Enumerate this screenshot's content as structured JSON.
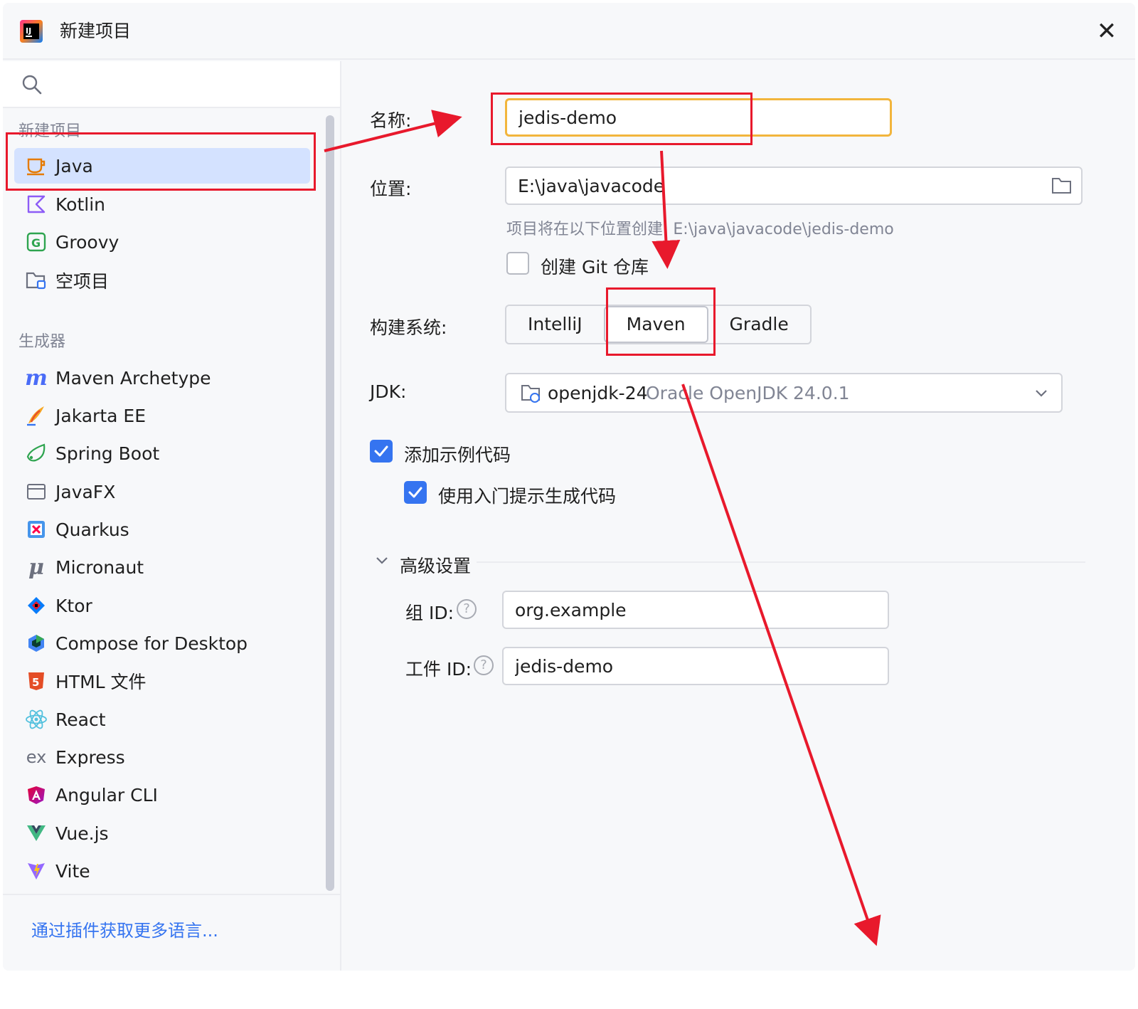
{
  "window": {
    "title": "新建项目",
    "close_glyph": "✕"
  },
  "search": {
    "placeholder": ""
  },
  "sidebar": {
    "section_new": "新建项目",
    "new_items": [
      {
        "label": "Java",
        "icon": "java-cup-icon"
      },
      {
        "label": "Kotlin",
        "icon": "kotlin-icon"
      },
      {
        "label": "Groovy",
        "icon": "groovy-icon"
      },
      {
        "label": "空项目",
        "icon": "empty-project-icon"
      }
    ],
    "section_generators": "生成器",
    "generators": [
      {
        "label": "Maven Archetype",
        "icon": "maven-icon"
      },
      {
        "label": "Jakarta EE",
        "icon": "jakarta-icon"
      },
      {
        "label": "Spring Boot",
        "icon": "spring-boot-icon"
      },
      {
        "label": "JavaFX",
        "icon": "javafx-icon"
      },
      {
        "label": "Quarkus",
        "icon": "quarkus-icon"
      },
      {
        "label": "Micronaut",
        "icon": "micronaut-icon"
      },
      {
        "label": "Ktor",
        "icon": "ktor-icon"
      },
      {
        "label": "Compose for Desktop",
        "icon": "compose-icon"
      },
      {
        "label": "HTML 文件",
        "icon": "html5-icon"
      },
      {
        "label": "React",
        "icon": "react-icon"
      },
      {
        "label": "Express",
        "icon": "express-icon"
      },
      {
        "label": "Angular CLI",
        "icon": "angular-icon"
      },
      {
        "label": "Vue.js",
        "icon": "vue-icon"
      },
      {
        "label": "Vite",
        "icon": "vite-icon"
      }
    ],
    "more_link": "通过插件获取更多语言..."
  },
  "form": {
    "name_label": "名称:",
    "name_value": "jedis-demo",
    "location_label": "位置:",
    "location_value": "E:\\java\\javacode",
    "location_hint": "项目将在以下位置创建: E:\\java\\javacode\\jedis-demo",
    "git_label": "创建 Git 仓库",
    "build_label": "构建系统:",
    "build_options": [
      "IntelliJ",
      "Maven",
      "Gradle"
    ],
    "build_selected": "Maven",
    "jdk_label": "JDK:",
    "jdk_name": "openjdk-24",
    "jdk_desc": "Oracle OpenJDK 24.0.1",
    "sample_code_label": "添加示例代码",
    "onboarding_label": "使用入门提示生成代码",
    "advanced_label": "高级设置",
    "group_label": "组 ID:",
    "group_value": "org.example",
    "artifact_label": "工件 ID:",
    "artifact_value": "jedis-demo",
    "help_glyph": "?"
  },
  "colors": {
    "accent": "#3574f0",
    "selection": "#d4e2ff",
    "focus_border": "#f2b53c",
    "annotation_red": "#e8192c"
  }
}
